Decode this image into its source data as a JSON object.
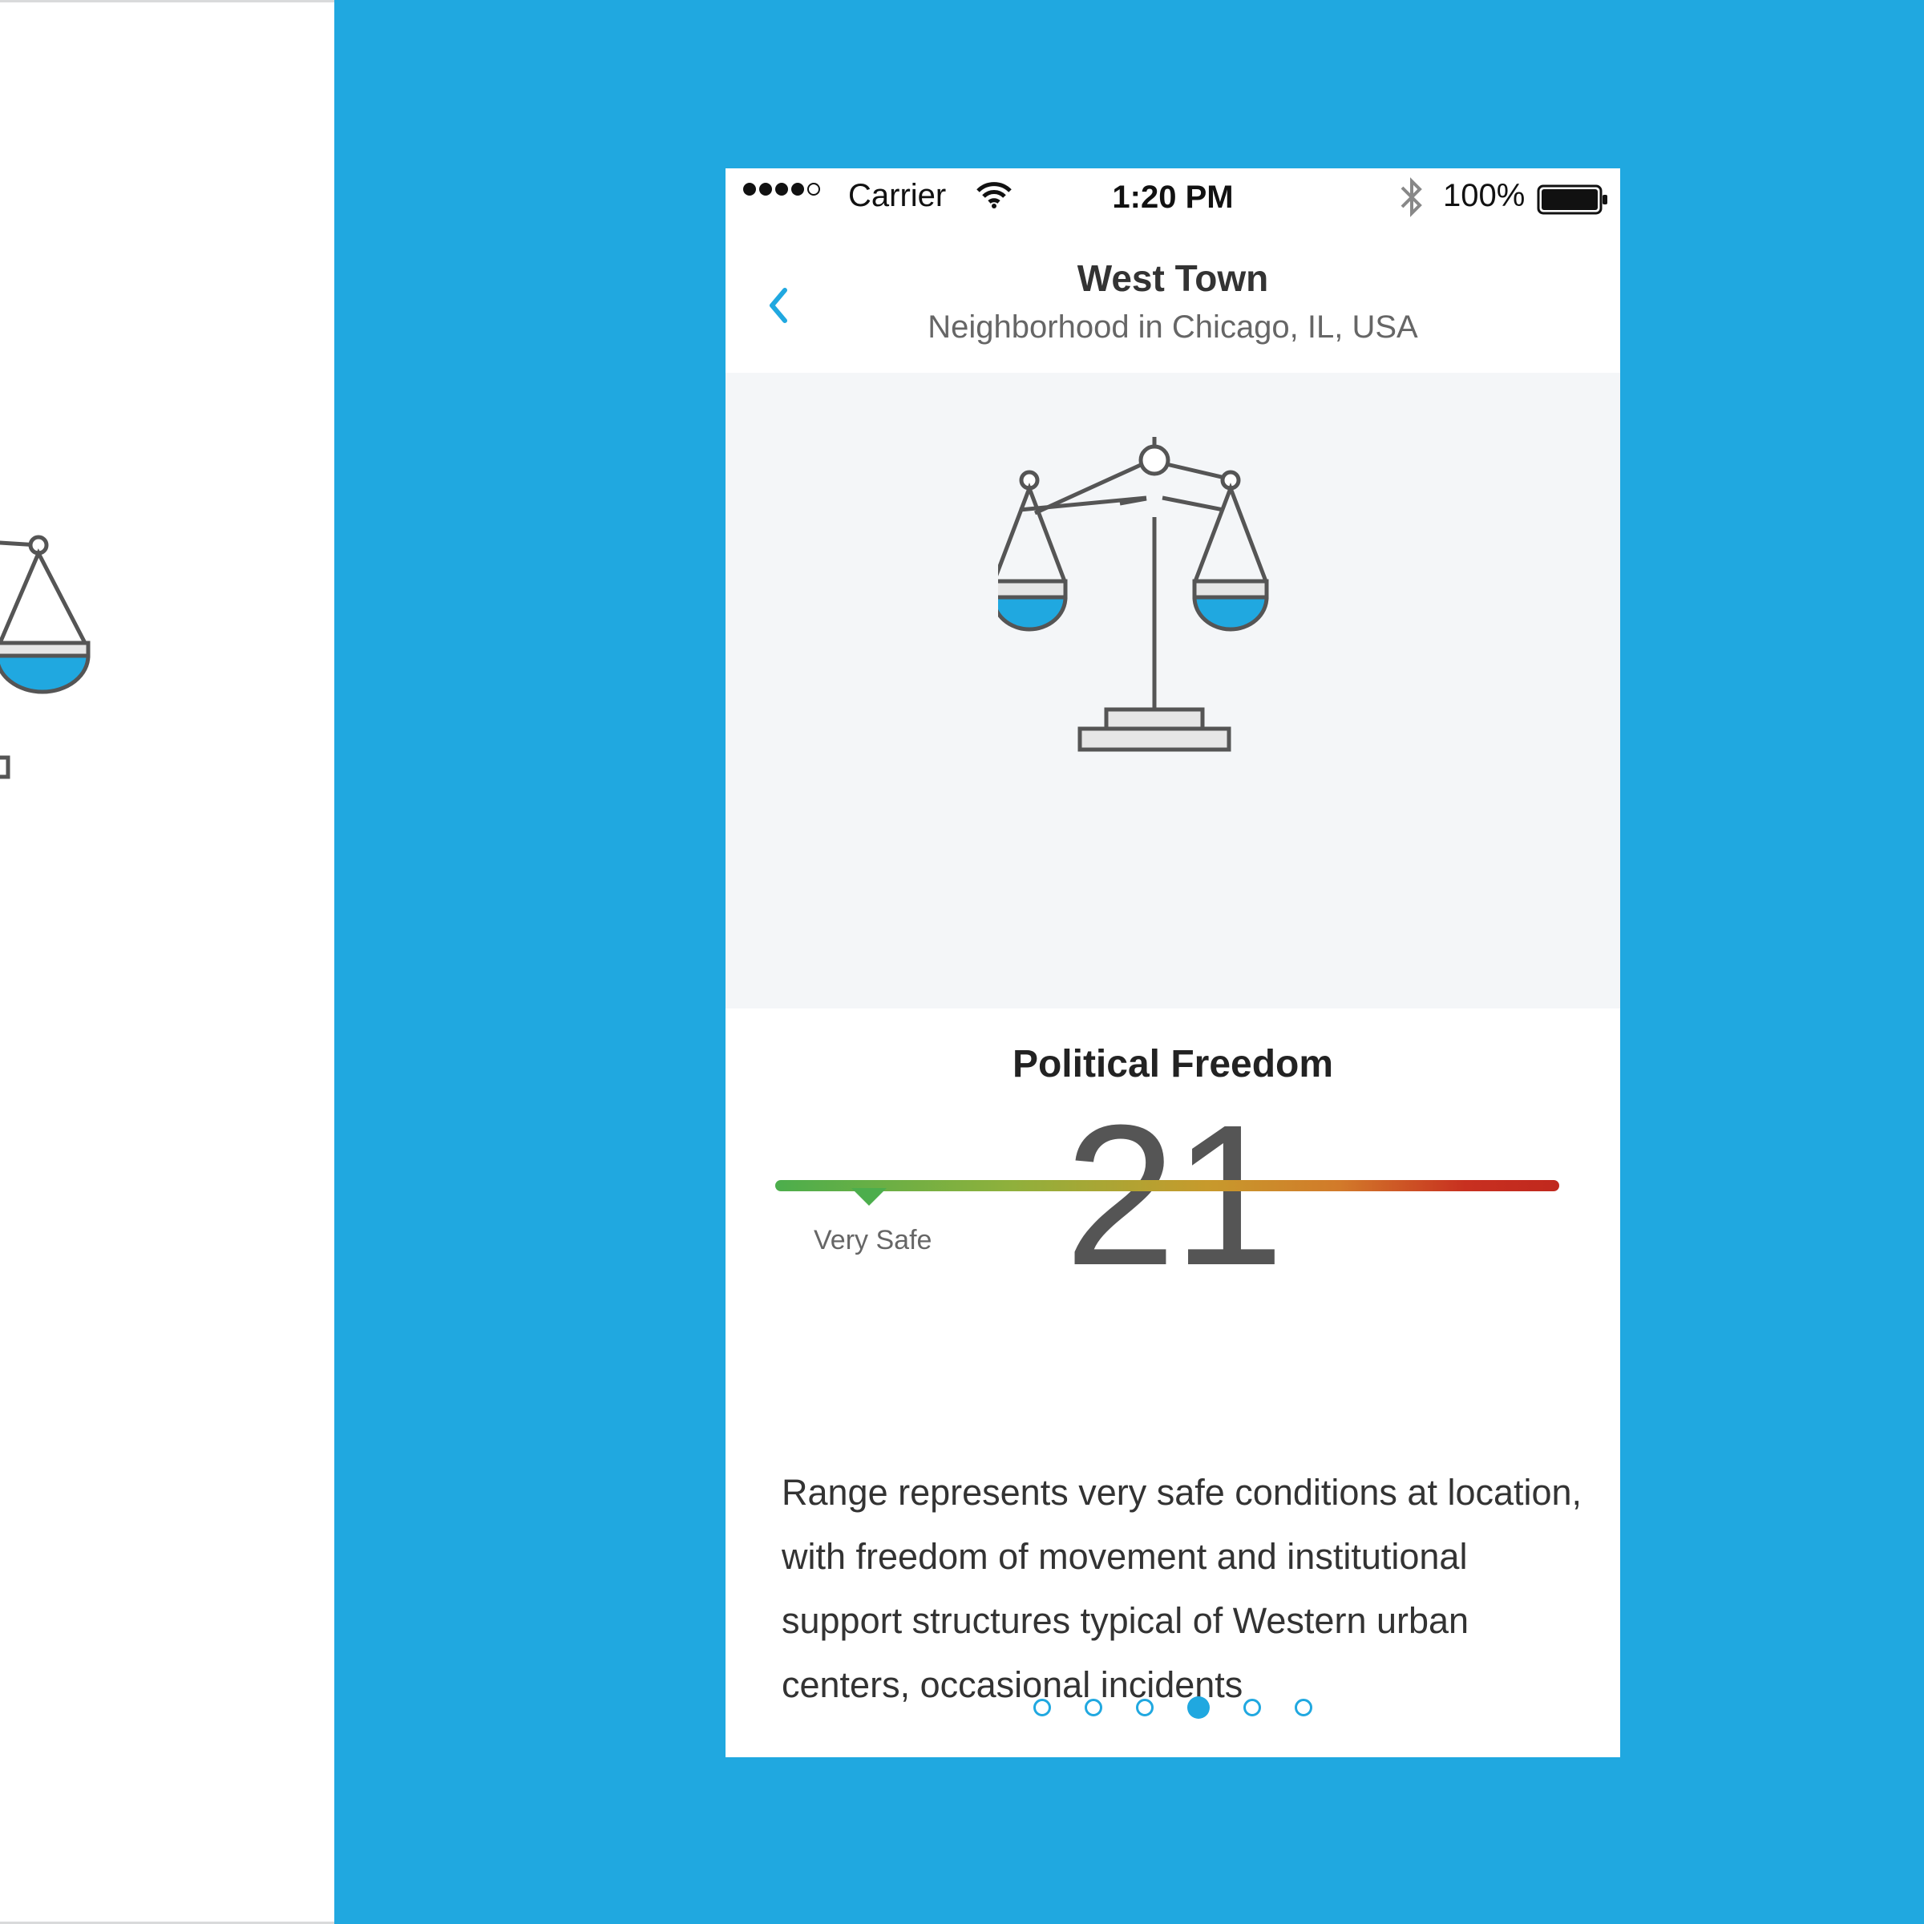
{
  "status_bar": {
    "carrier": "Carrier",
    "time": "1:20 PM",
    "battery": "100%",
    "icons": [
      "signal-dots-icon",
      "wifi-icon",
      "bluetooth-icon",
      "battery-icon"
    ]
  },
  "nav": {
    "title": "West Town",
    "subtitle": "Neighborhood in Chicago, IL, USA",
    "back_icon": "chevron-left-icon"
  },
  "hero": {
    "icon": "scales-of-justice-icon"
  },
  "metric": {
    "title": "Political Freedom",
    "value": "21",
    "level_label": "Very Safe",
    "level_fraction": 0.12,
    "gradient_colors": [
      "#4cae4c",
      "#c79a2c",
      "#c0281e"
    ]
  },
  "description": "Range represents very safe conditions at location, with freedom of movement and institutional support structures typical of Western urban centers, occasional incidents",
  "pager": {
    "count": 6,
    "active_index": 3
  },
  "colors": {
    "accent": "#20a8e0",
    "background": "#20a8e0",
    "hero_bg": "#f4f6f8"
  }
}
